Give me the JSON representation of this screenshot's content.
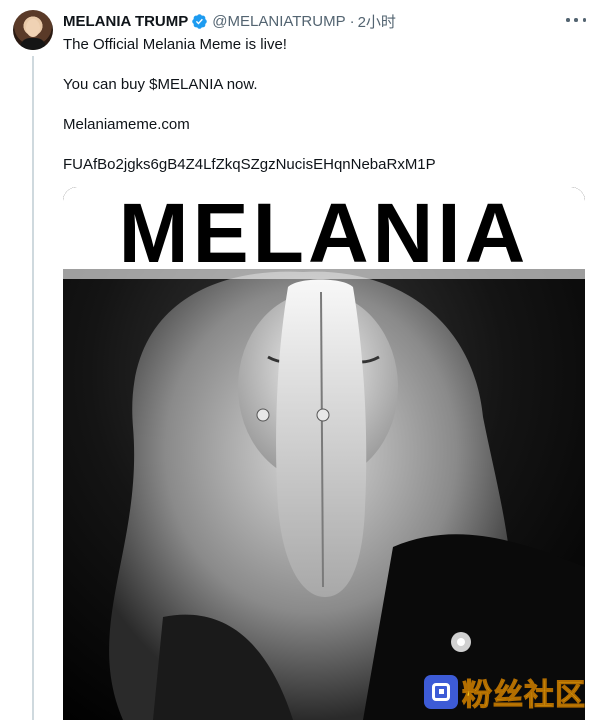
{
  "tweet": {
    "author_name": "MELANIA TRUMP",
    "author_handle": "@MELANIATRUMP",
    "separator": "·",
    "time": "2小时",
    "lines": [
      "The Official Melania Meme is live!",
      "You can buy $MELANIA now.",
      "Melaniameme.com",
      "FUAfBo2jgks6gB4Z4LfZkqSZgzNucisEHqnNebaRxM1P"
    ],
    "media": {
      "title_text": "MELANIA"
    }
  },
  "watermark": {
    "text": "粉丝社区"
  },
  "colors": {
    "verified_badge": "#1d9bf0",
    "secondary_text": "#536471",
    "thread_line": "#cfd9de"
  },
  "icons": {
    "verified": "verified-badge-icon",
    "more": "more-options-icon"
  }
}
